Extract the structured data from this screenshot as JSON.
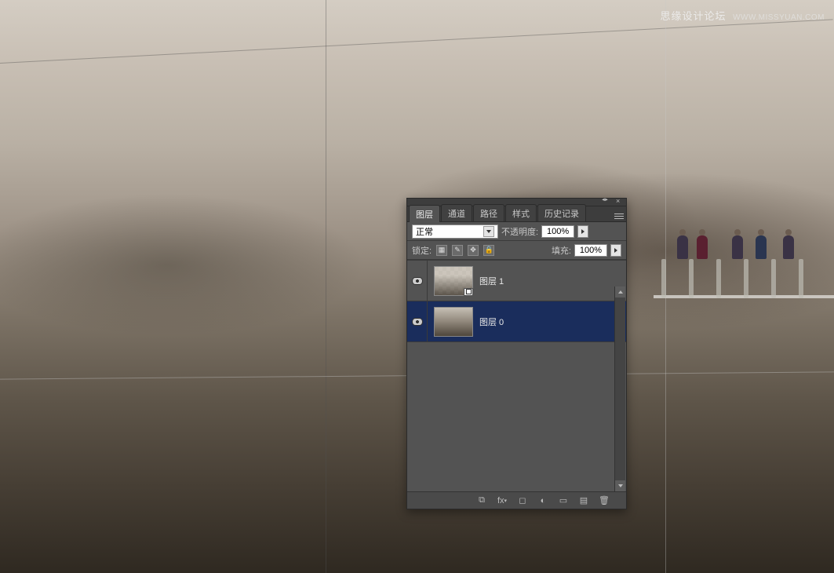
{
  "watermark": {
    "text": "思缘设计论坛",
    "url": "WWW.MISSYUAN.COM"
  },
  "panel": {
    "tabs": {
      "layers": "图层",
      "channels": "通道",
      "paths": "路径",
      "styles": "样式",
      "history": "历史记录"
    },
    "blend_mode": "正常",
    "opacity_label": "不透明度:",
    "opacity_value": "100%",
    "lock_label": "锁定:",
    "fill_label": "填充:",
    "fill_value": "100%",
    "layers": [
      {
        "name": "图层 1",
        "selected": false,
        "smart": true
      },
      {
        "name": "图层 0",
        "selected": true,
        "smart": false
      }
    ]
  }
}
